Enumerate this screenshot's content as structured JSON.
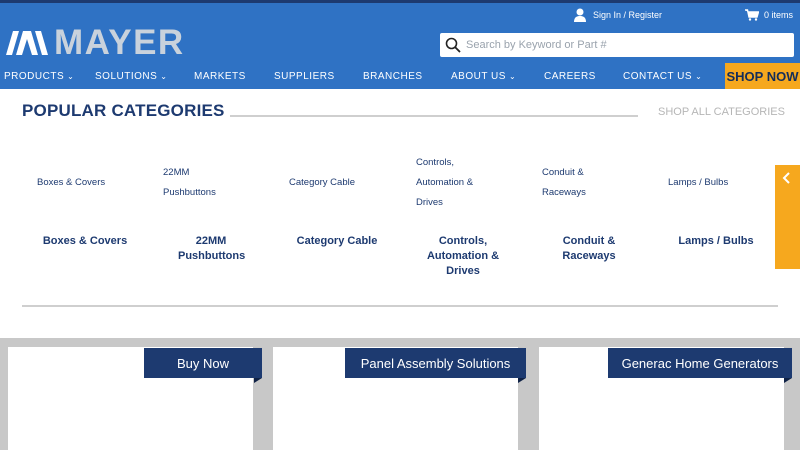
{
  "header": {
    "brand": "MAYER",
    "sign_in": "Sign In / Register",
    "cart": "0 items",
    "search_placeholder": "Search by Keyword or Part #"
  },
  "nav": {
    "items": [
      {
        "label": "PRODUCTS",
        "dropdown": true
      },
      {
        "label": "SOLUTIONS",
        "dropdown": true
      },
      {
        "label": "MARKETS",
        "dropdown": false
      },
      {
        "label": "SUPPLIERS",
        "dropdown": false
      },
      {
        "label": "BRANCHES",
        "dropdown": false
      },
      {
        "label": "ABOUT US",
        "dropdown": true
      },
      {
        "label": "CAREERS",
        "dropdown": false
      },
      {
        "label": "CONTACT US",
        "dropdown": true
      }
    ],
    "shop_now": "SHOP NOW"
  },
  "popular": {
    "title": "POPULAR CATEGORIES",
    "shop_all": "SHOP ALL CATEGORIES",
    "categories": [
      {
        "image_alt": "Boxes & Covers",
        "name": "Boxes & Covers"
      },
      {
        "image_alt": "22MM Pushbuttons",
        "name": "22MM Pushbuttons"
      },
      {
        "image_alt": "Category Cable",
        "name": "Category Cable"
      },
      {
        "image_alt": "Controls, Automation & Drives",
        "name": "Controls, Automation & Drives"
      },
      {
        "image_alt": "Conduit & Raceways",
        "name": "Conduit & Raceways"
      },
      {
        "image_alt": "Lamps / Bulbs",
        "name": "Lamps / Bulbs"
      }
    ]
  },
  "cards": [
    {
      "banner": "Buy Now"
    },
    {
      "banner": "Panel Assembly Solutions"
    },
    {
      "banner": "Generac Home Generators"
    }
  ],
  "colors": {
    "header_blue": "#2f72c4",
    "navy": "#1d3a70",
    "accent_orange": "#f6a81e"
  },
  "icons": {
    "user": "user-icon",
    "cart": "cart-icon",
    "search": "search-icon",
    "dropdown": "chevron-down-icon",
    "slider_prev": "chevron-left-icon"
  }
}
